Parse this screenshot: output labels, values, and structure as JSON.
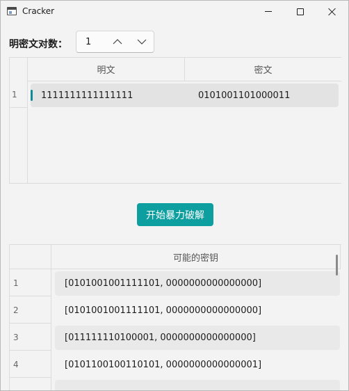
{
  "window": {
    "title": "Cracker"
  },
  "pair_count": {
    "label": "明密文对数：",
    "value": "1"
  },
  "pairs_table": {
    "columns": [
      "明文",
      "密文"
    ],
    "rows": [
      {
        "index": "1",
        "plaintext": "1111111111111111",
        "ciphertext": "0101001101000011"
      }
    ]
  },
  "action": {
    "crack_label": "开始暴力破解",
    "accent_color": "#0d9ea0"
  },
  "keys_table": {
    "column": "可能的密钥",
    "rows": [
      {
        "index": "1",
        "key": "[0101001001111101, 0000000000000000]"
      },
      {
        "index": "2",
        "key": "[0101001001111101, 0000000000000000]"
      },
      {
        "index": "3",
        "key": "[011111110100001, 0000000000000000]"
      },
      {
        "index": "4",
        "key": "[0101100100110101, 0000000000000001]"
      }
    ]
  },
  "icons": {
    "app": "window-app-icon",
    "minimize": "minimize-icon",
    "maximize": "maximize-icon",
    "close": "close-icon",
    "increment": "chevron-up-icon",
    "decrement": "chevron-down-icon"
  }
}
